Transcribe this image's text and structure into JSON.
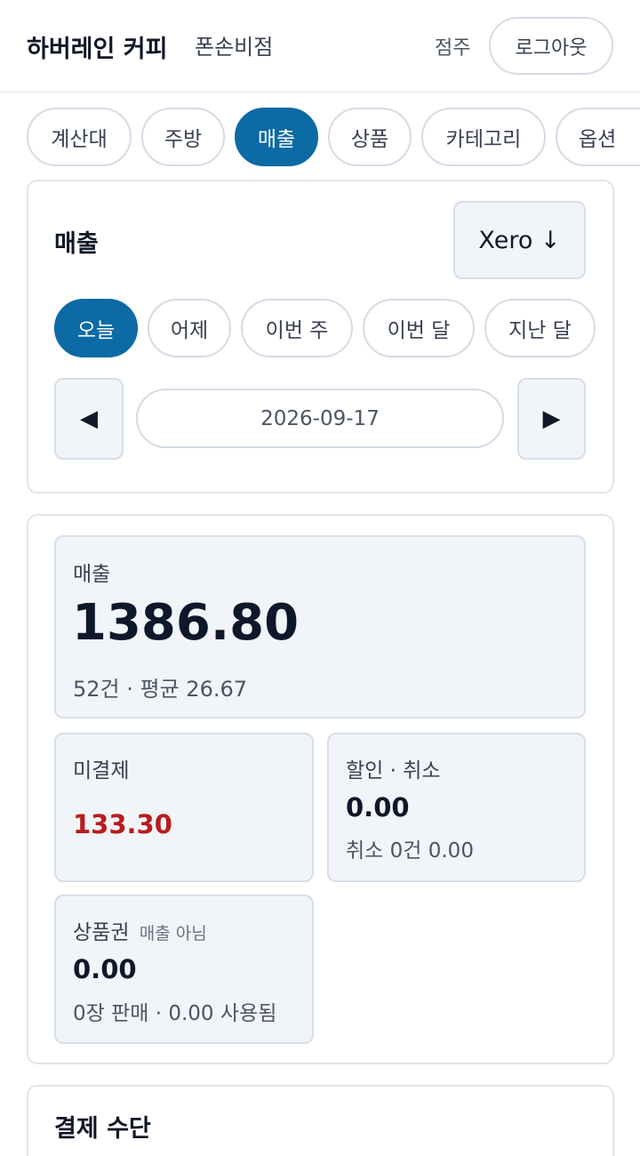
{
  "header": {
    "brand": "하버레인 커피",
    "store": "폰손비점",
    "role": "점주",
    "logout_label": "로그아웃"
  },
  "nav": {
    "tabs": [
      {
        "label": "계산대",
        "active": false
      },
      {
        "label": "주방",
        "active": false
      },
      {
        "label": "매출",
        "active": true
      },
      {
        "label": "상품",
        "active": false
      },
      {
        "label": "카테고리",
        "active": false
      },
      {
        "label": "옵션",
        "active": false
      }
    ]
  },
  "sales_panel": {
    "title": "매출",
    "export_label": "Xero ↓",
    "ranges": [
      {
        "label": "오늘",
        "active": true
      },
      {
        "label": "어제",
        "active": false
      },
      {
        "label": "이번 주",
        "active": false
      },
      {
        "label": "이번 달",
        "active": false
      },
      {
        "label": "지난 달",
        "active": false
      }
    ],
    "prev_icon": "◀",
    "next_icon": "▶",
    "date": "2026-09-17"
  },
  "summary": {
    "sales": {
      "label": "매출",
      "value": "1386.80",
      "detail": "52건 · 평균 26.67"
    },
    "unpaid": {
      "label": "미결제",
      "value": "133.30",
      "color": "#b91c1c"
    },
    "discount": {
      "label": "할인 · 취소",
      "value": "0.00",
      "detail": "취소 0건 0.00"
    },
    "voucher": {
      "label": "상품권",
      "note": "매출 아님",
      "value": "0.00",
      "detail": "0장 판매 · 0.00 사용됨"
    }
  },
  "payment_section": {
    "title": "결제 수단"
  },
  "colors": {
    "accent": "#0c6aa4",
    "unpaid": "#b91c1c"
  }
}
